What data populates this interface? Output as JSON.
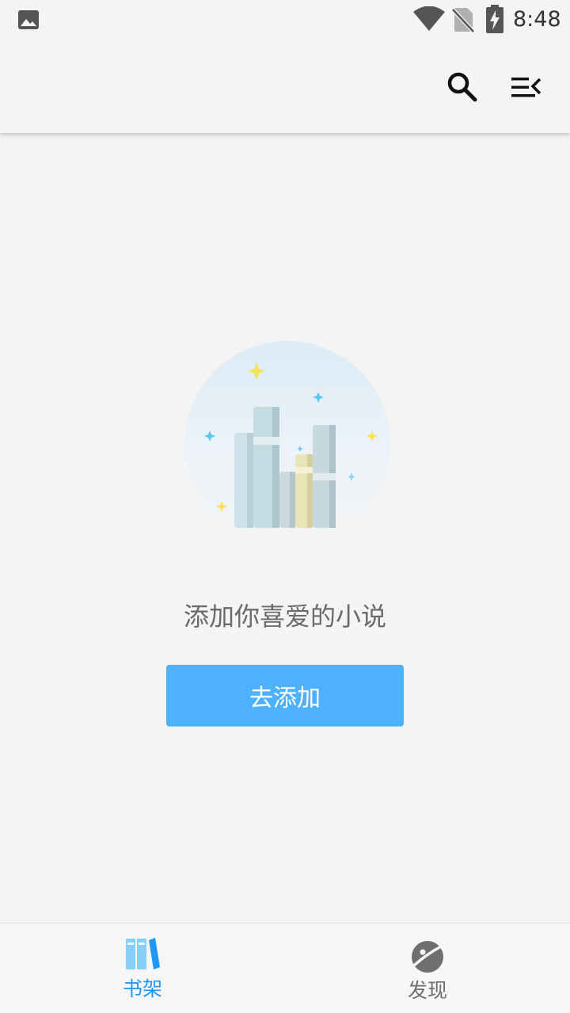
{
  "status_bar": {
    "time": "8:48",
    "icons": [
      "gallery-icon",
      "wifi-icon",
      "no-sim-icon",
      "battery-charging-icon"
    ]
  },
  "toolbar": {
    "icons": [
      "search-icon",
      "menu-collapse-icon"
    ]
  },
  "empty_state": {
    "illustration": "bookshelf-illustration",
    "message": "添加你喜爱的小说",
    "button_label": "去添加",
    "button_color": "#4db1fb"
  },
  "bottom_nav": {
    "items": [
      {
        "label": "书架",
        "icon": "bookshelf-icon",
        "active": true,
        "color": "#2196f3"
      },
      {
        "label": "发现",
        "icon": "planet-icon",
        "active": false,
        "color": "#6f6f6f"
      }
    ]
  },
  "colors": {
    "background": "#f4f4f4",
    "accent": "#2196f3",
    "button": "#4db1fb"
  }
}
